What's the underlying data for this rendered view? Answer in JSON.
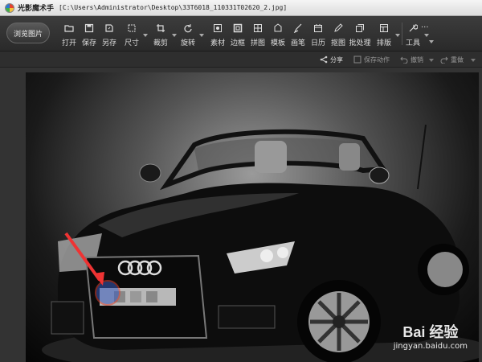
{
  "window": {
    "app_name": "光影魔术手",
    "file_path": "[C:\\Users\\Administrator\\Desktop\\33T6018_110331T02620_2.jpg]"
  },
  "toolbar": {
    "browse_label": "浏览图片",
    "tools": [
      {
        "label": "打开",
        "icon": "open-icon"
      },
      {
        "label": "保存",
        "icon": "save-icon"
      },
      {
        "label": "另存",
        "icon": "save-as-icon"
      },
      {
        "label": "尺寸",
        "icon": "resize-icon"
      },
      {
        "label": "裁剪",
        "icon": "crop-icon"
      },
      {
        "label": "旋转",
        "icon": "rotate-icon"
      },
      {
        "label": "素材",
        "icon": "material-icon"
      },
      {
        "label": "边框",
        "icon": "frame-icon"
      },
      {
        "label": "拼图",
        "icon": "collage-icon"
      },
      {
        "label": "模板",
        "icon": "template-icon"
      },
      {
        "label": "画笔",
        "icon": "brush-icon"
      },
      {
        "label": "日历",
        "icon": "calendar-icon"
      },
      {
        "label": "抠图",
        "icon": "cutout-icon"
      },
      {
        "label": "批处理",
        "icon": "batch-icon"
      },
      {
        "label": "排版",
        "icon": "layout-icon"
      },
      {
        "label": "工具",
        "icon": "tools-icon"
      }
    ],
    "more_label": "..."
  },
  "actions": {
    "share": "分享",
    "save_action": "保存动作",
    "undo": "撤销",
    "redo": "重做"
  },
  "photo": {
    "watermark_main": "Bai 经验",
    "watermark_sub": "jingyan.baidu.com"
  }
}
